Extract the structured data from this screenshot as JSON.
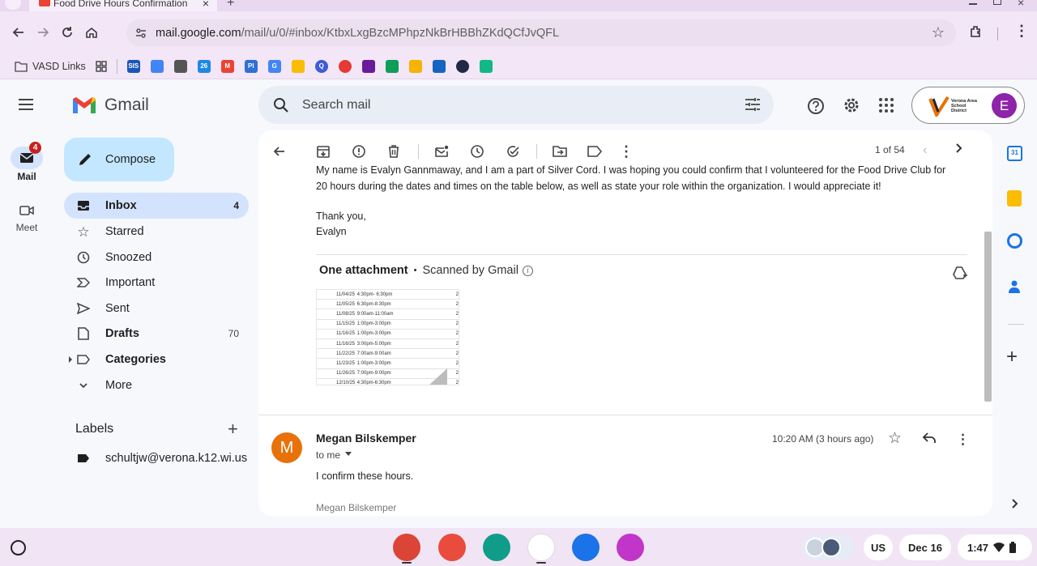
{
  "browser": {
    "tab_title": "Food Drive Hours Confirmation",
    "tab_close": "×",
    "new_tab": "+",
    "url_host": "mail.google.com",
    "url_path": "/mail/u/0/#inbox/KtbxLxgBzcMPhpzNkBrHBBhZKdQCfJvQFL",
    "bookmarks_folder": "VASD Links",
    "bookmark_icons": [
      {
        "name": "sis",
        "label": "SIS",
        "color": "#1a56b8"
      },
      {
        "name": "docs",
        "label": "",
        "color": "#4285f4"
      },
      {
        "name": "shield",
        "label": "",
        "color": "#555555"
      },
      {
        "name": "calendar",
        "label": "26",
        "color": "#1e88e5"
      },
      {
        "name": "gmail",
        "label": "M",
        "color": "#ea4335"
      },
      {
        "name": "pl",
        "label": "Pl",
        "color": "#2f6fd6"
      },
      {
        "name": "google",
        "label": "G",
        "color": "#4285f4"
      },
      {
        "name": "drive",
        "label": "",
        "color": "#fbbc04"
      },
      {
        "name": "q",
        "label": "Q",
        "color": "#3b5bdb"
      },
      {
        "name": "ring",
        "label": "",
        "color": "#e53935"
      },
      {
        "name": "dots",
        "label": "",
        "color": "#6a1b9a"
      },
      {
        "name": "green",
        "label": "",
        "color": "#0f9d58"
      },
      {
        "name": "slides",
        "label": "",
        "color": "#f4b400"
      },
      {
        "name": "blue",
        "label": "",
        "color": "#1565c0"
      },
      {
        "name": "dark",
        "label": "",
        "color": "#202a44"
      },
      {
        "name": "teal",
        "label": "",
        "color": "#12b886"
      }
    ]
  },
  "gmail": {
    "logo_text": "Gmail",
    "search_placeholder": "Search mail",
    "compose_label": "Compose",
    "rail": {
      "mail_label": "Mail",
      "mail_badge": "4",
      "meet_label": "Meet"
    },
    "nav": [
      {
        "label": "Inbox",
        "count": "4",
        "icon": "inbox-icon",
        "bold": true,
        "selected": true
      },
      {
        "label": "Starred",
        "count": "",
        "icon": "star-icon",
        "bold": false,
        "selected": false
      },
      {
        "label": "Snoozed",
        "count": "",
        "icon": "clock-icon",
        "bold": false,
        "selected": false
      },
      {
        "label": "Important",
        "count": "",
        "icon": "important-icon",
        "bold": false,
        "selected": false
      },
      {
        "label": "Sent",
        "count": "",
        "icon": "send-icon",
        "bold": false,
        "selected": false
      },
      {
        "label": "Drafts",
        "count": "70",
        "icon": "draft-icon",
        "bold": true,
        "selected": false
      },
      {
        "label": "Categories",
        "count": "",
        "icon": "label-icon",
        "bold": true,
        "selected": false
      },
      {
        "label": "More",
        "count": "",
        "icon": "chevron-down-icon",
        "bold": false,
        "selected": false
      }
    ],
    "labels_heading": "Labels",
    "labels_add": "+",
    "labels": [
      "schultjw@verona.k12.wi.us"
    ],
    "org_name": "Verona Area School District",
    "avatar_letter": "E",
    "pager": "1 of 54"
  },
  "message": {
    "body_line1": "My name is Evalyn Gannmaway, and I am a part of Silver Cord. I was hoping you could confirm that I volunteered for the Food Drive Club for",
    "body_line2": "20 hours during the dates and times on the table below, as well as state your role within the organization. I would appreciate it!",
    "signoff": "Thank you,",
    "signature": "Evalyn",
    "attachment_heading": "One attachment",
    "attachment_dot": "•",
    "attachment_scan": "Scanned by Gmail",
    "attachment_rows": [
      {
        "date": "11/04/25",
        "time": "4:30pm- 6:30pm",
        "hours": "2"
      },
      {
        "date": "11/05/25",
        "time": "6:30pm-8:30pm",
        "hours": "2"
      },
      {
        "date": "11/08/25",
        "time": "9:00am-11:00am",
        "hours": "2"
      },
      {
        "date": "11/15/25",
        "time": "1:00pm-3:00pm",
        "hours": "2"
      },
      {
        "date": "11/16/25",
        "time": "1:00pm-3:00pm",
        "hours": "2"
      },
      {
        "date": "11/16/25",
        "time": "3:00pm-5:00pm",
        "hours": "2"
      },
      {
        "date": "11/22/25",
        "time": "7:00am-9:00am",
        "hours": "2"
      },
      {
        "date": "11/23/25",
        "time": "1:00pm-3:00pm",
        "hours": "2"
      },
      {
        "date": "11/26/25",
        "time": "7:00pm-9:00pm",
        "hours": "2"
      },
      {
        "date": "12/10/25",
        "time": "4:30pm-6:30pm",
        "hours": "2"
      }
    ]
  },
  "reply": {
    "sender": "Megan Bilskemper",
    "avatar_letter": "M",
    "avatar_color": "#e8710a",
    "time": "10:20 AM (3 hours ago)",
    "recipient": "to me",
    "body": "I confirm these hours.",
    "signature": "Megan Bilskemper"
  },
  "shelf": {
    "keyboard": "US",
    "date": "Dec 16",
    "time": "1:47",
    "apps": [
      {
        "name": "chrome",
        "color": "#db4437"
      },
      {
        "name": "palette",
        "color": "#e94b3c"
      },
      {
        "name": "classroom",
        "color": "#0f9d8a"
      },
      {
        "name": "play-store",
        "color": "#ffffff"
      },
      {
        "name": "files",
        "color": "#1a73e8"
      },
      {
        "name": "canvas",
        "color": "#c235c9"
      }
    ]
  }
}
